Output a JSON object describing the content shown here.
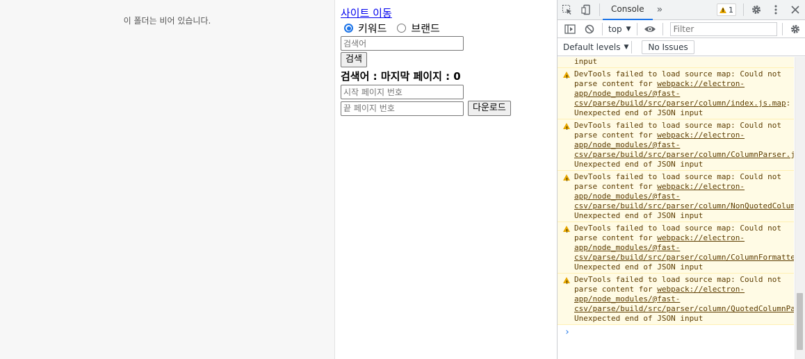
{
  "explorer": {
    "empty_message": "이 폴더는 비어 있습니다."
  },
  "app": {
    "site_link": "사이트 이동",
    "radio_options": [
      {
        "label": "키워드",
        "checked": true
      },
      {
        "label": "브랜드",
        "checked": false
      }
    ],
    "search_placeholder": "검색어",
    "search_button": "검색",
    "status_text": "검색어 : 마지막 페이지 : 0",
    "start_page_placeholder": "시작 페이지 번호",
    "end_page_placeholder": "끝 페이지 번호",
    "download_button": "다운로드"
  },
  "devtools": {
    "active_tab": "Console",
    "more_tabs": "»",
    "warning_count": "1",
    "context": "top",
    "filter_placeholder": "Filter",
    "default_levels": "Default levels",
    "issues_button": "No Issues",
    "partial_message": "input",
    "messages": [
      {
        "pre": "DevTools failed to load source map: Could not parse content for ",
        "link": "webpack://electron-app/node_modules/@fast-csv/parse/build/src/parser/column/index.js.map",
        "post": ": Unexpected end of JSON input"
      },
      {
        "pre": "DevTools failed to load source map: Could not parse content for ",
        "link": "webpack://electron-app/node_modules/@fast-csv/parse/build/src/parser/column/ColumnParser.js.map",
        "post": ": Unexpected end of JSON input"
      },
      {
        "pre": "DevTools failed to load source map: Could not parse content for ",
        "link": "webpack://electron-app/node_modules/@fast-csv/parse/build/src/parser/column/NonQuotedColumnParser.js.map",
        "post": ": Unexpected end of JSON input"
      },
      {
        "pre": "DevTools failed to load source map: Could not parse content for ",
        "link": "webpack://electron-app/node_modules/@fast-csv/parse/build/src/parser/column/ColumnFormatter.js.map",
        "post": ": Unexpected end of JSON input"
      },
      {
        "pre": "DevTools failed to load source map: Could not parse content for ",
        "link": "webpack://electron-app/node_modules/@fast-csv/parse/build/src/parser/column/QuotedColumnParser.js.map",
        "post": ": Unexpected end of JSON input"
      }
    ],
    "prompt_symbol": "›",
    "colors": {
      "accent": "#1a73e8",
      "warning_bg": "#fffbe5",
      "warning_text": "#5c3c00",
      "warning_icon": "#e6a600"
    }
  }
}
